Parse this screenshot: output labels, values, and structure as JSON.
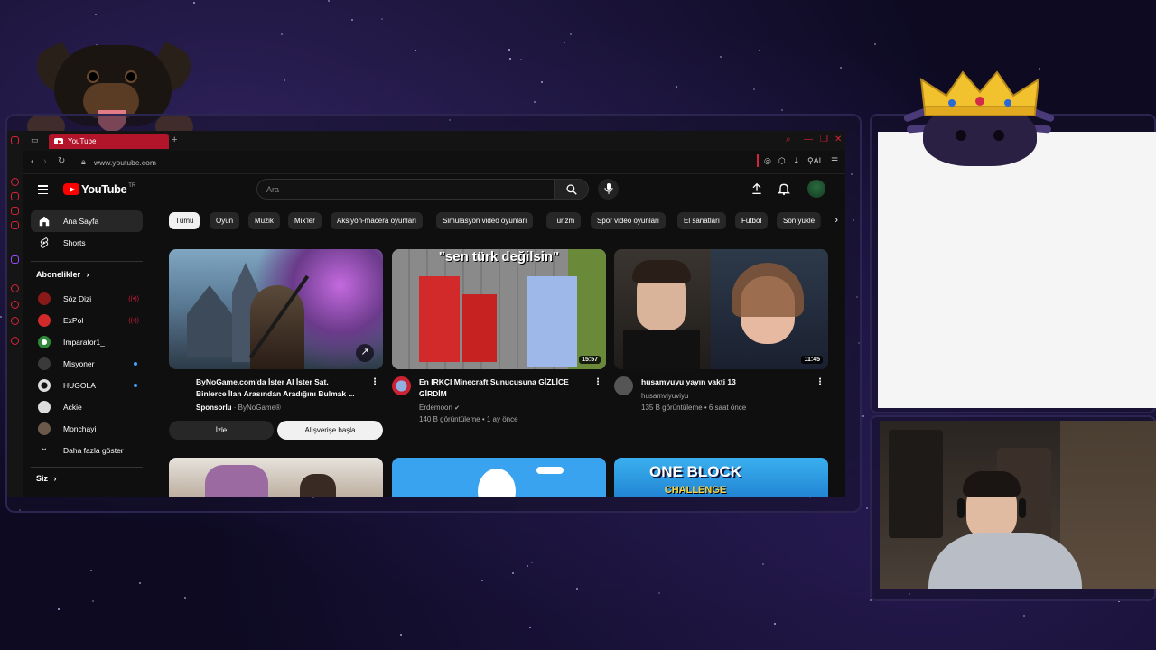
{
  "browser": {
    "tab_title": "YouTube",
    "url": "www.youtube.com",
    "ai_label": "AI"
  },
  "youtube": {
    "logo_text": "YouTube",
    "country_code": "TR",
    "search_placeholder": "Ara",
    "sidebar": {
      "home": "Ana Sayfa",
      "shorts": "Shorts",
      "subscriptions_header": "Abonelikler",
      "subscriptions": [
        {
          "name": "Söz Dizi",
          "status": "live"
        },
        {
          "name": "ExPol",
          "status": "live"
        },
        {
          "name": "Imparator1_",
          "status": ""
        },
        {
          "name": "Misyoner",
          "status": "new"
        },
        {
          "name": "HUGOLA",
          "status": "new"
        },
        {
          "name": "Ackie",
          "status": ""
        },
        {
          "name": "Monchayi",
          "status": ""
        }
      ],
      "show_more": "Daha fazla göster",
      "you_header": "Siz"
    },
    "chips": [
      "Tümü",
      "Oyun",
      "Müzik",
      "Mix'ler",
      "Aksiyon-macera oyunları",
      "Simülasyon video oyunları",
      "Turizm",
      "Spor video oyunları",
      "El sanatları",
      "Futbol",
      "Son yükle"
    ],
    "videos": [
      {
        "title_line1": "ByNoGame.com'da İster Al İster Sat.",
        "title_line2": "Binlerce İlan Arasından Aradığını Bulmak ...",
        "sponsored": "Sponsorlu",
        "channel": "ByNoGame®",
        "watch_button": "İzle",
        "shop_button": "Alışverişe başla"
      },
      {
        "thumb_text": "\"sen türk değilsin\"",
        "duration": "15:57",
        "title_line1": "En IRKÇI Minecraft Sunucusuna GİZLİCE",
        "title_line2": "GİRDİM",
        "channel": "Erdemoon",
        "views": "140 B görüntüleme",
        "age": "1 ay önce"
      },
      {
        "duration": "11:45",
        "title_line1": "husamyuyu yayın vakti 13",
        "channel": "husamviyuviyu",
        "views": "135 B görüntüleme",
        "age": "6 saat önce"
      }
    ],
    "row2_thumb_text": "ONE BLOCK",
    "row2_thumb_text2": "CHALLENGE"
  },
  "colors": {
    "yt_red": "#ff0000",
    "opera_red": "#d6223a",
    "chip_bg": "#272727",
    "page_bg": "#0f0f0f"
  },
  "icons": [
    "home-icon",
    "shorts-icon",
    "search-icon",
    "mic-icon",
    "upload-icon",
    "bell-icon",
    "chevron-right-icon",
    "chevron-down-icon",
    "more-vert-icon",
    "external-link-icon"
  ]
}
